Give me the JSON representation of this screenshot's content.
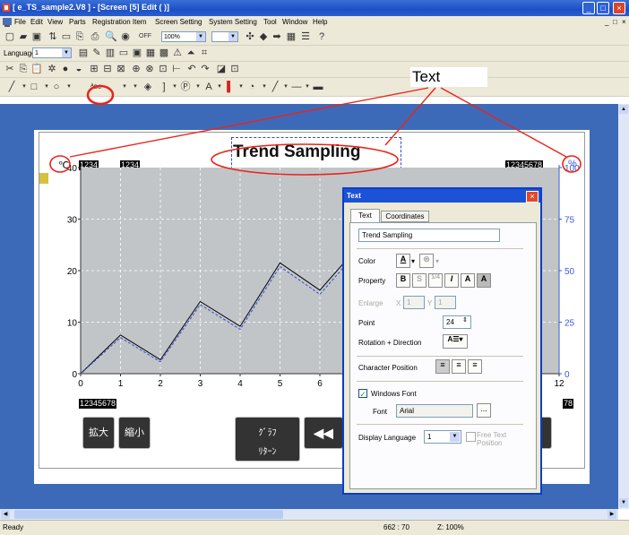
{
  "window": {
    "title": "[ e_TS_sample2.V8 ] - [Screen [5] Edit (          )]",
    "buttons": [
      "_",
      "□",
      "×"
    ]
  },
  "menu": {
    "items": [
      "File",
      "Edit",
      "View",
      "Parts",
      "Registration Item",
      "Screen Setting",
      "System Setting",
      "Tool",
      "Window",
      "Help"
    ],
    "right_controls": [
      "_",
      "□",
      "×"
    ]
  },
  "toolbar": {
    "off_label": "OFF",
    "zoom": "100%",
    "language_label": "Language",
    "language_value": "1",
    "text_tool_label": "ᴬʙc"
  },
  "annotation": {
    "label": "Text",
    "accent": "#e8251a"
  },
  "screen": {
    "title": "Trend Sampling",
    "celsius": "℃",
    "percent": "%",
    "box1": "1234",
    "box2": "1234",
    "box3": "12345678",
    "box_bottom_left": "12345678",
    "box_bottom_right": "78",
    "buttons": {
      "zoom_in": "拡大",
      "zoom_out": "縮小",
      "graph_return_1": "ｸﾞﾗﾌ",
      "graph_return_2": "ﾘﾀｰﾝ",
      "rewind": "◀◀"
    }
  },
  "chart_data": {
    "type": "line",
    "xlim": [
      0,
      12
    ],
    "ylim_left": [
      0,
      40
    ],
    "ylim_right": [
      0,
      100
    ],
    "x_ticks": [
      "0",
      "1",
      "2",
      "3",
      "4",
      "5",
      "6",
      "12"
    ],
    "y_ticks_left": [
      "40",
      "30",
      "20",
      "10",
      "0"
    ],
    "y_ticks_right": [
      "100",
      "75",
      "50",
      "25",
      "0"
    ],
    "series": [
      {
        "color": "#000000",
        "x": [
          0,
          1,
          2,
          3,
          4,
          5,
          6,
          7
        ],
        "y": [
          0,
          7.5,
          2.7,
          14,
          9.2,
          21.5,
          16.2,
          25
        ]
      },
      {
        "color": "#3b4bd6",
        "x": [
          0,
          1,
          2,
          3,
          4,
          5,
          6,
          7
        ],
        "y": [
          0,
          7,
          2.3,
          13.4,
          8.6,
          20.8,
          15.4,
          24.2
        ]
      }
    ]
  },
  "dialog": {
    "title": "Text",
    "close": "×",
    "tabs": [
      "Text",
      "Coordinates"
    ],
    "text_value": "Trend Sampling",
    "color_label": "Color",
    "property_label": "Property",
    "property_buttons": [
      "B",
      "S",
      "1/4",
      "I",
      "A",
      "A"
    ],
    "enlarge_label": "Enlarge",
    "enlarge_x_label": "X",
    "enlarge_x": "1",
    "enlarge_y_label": "Y",
    "enlarge_y": "1",
    "point_label": "Point",
    "point_value": "24",
    "rotation_label": "Rotation + Direction",
    "char_position_label": "Character Position",
    "windows_font_label": "Windows Font",
    "font_label": "Font",
    "font_value": "Arial",
    "browse": "...",
    "display_language_label": "Display Language",
    "display_language_value": "1",
    "free_text_label_1": "Free Text",
    "free_text_label_2": "Position"
  },
  "status": {
    "left": "Ready",
    "coords": "662 : 70",
    "zoom": "Z: 100%"
  }
}
